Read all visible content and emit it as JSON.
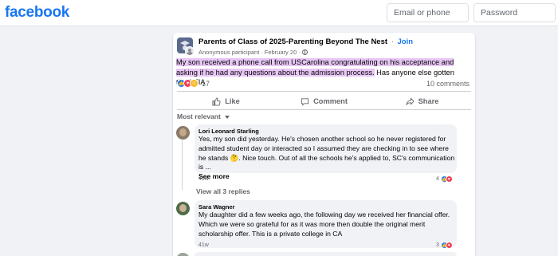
{
  "header": {
    "logo": "facebook",
    "email_placeholder": "Email or phone",
    "password_placeholder": "Password"
  },
  "post": {
    "group_name": "Parents of Class of 2025-Parenting Beyond The Nest",
    "separator": "·",
    "join_label": "Join",
    "author": "Anonymous participant",
    "date": "February 20",
    "body_highlighted": "My son received a phone call from USCarolina  congratulating on his acceptance and asking if he had any questions about the admission process.",
    "body_rest": " Has anyone else gotten this?  TIA",
    "reaction_count": "17",
    "comments_label": "10 comments",
    "actions": {
      "like": "Like",
      "comment": "Comment",
      "share": "Share"
    }
  },
  "comments_section": {
    "sort_label": "Most relevant",
    "view_replies": "View all 3 replies",
    "items": [
      {
        "author": "Lori Leonard Starling",
        "text": "Yes, my son did yesterday. He's chosen another school so he never registered for admitted student day or interacted so I assumed they are checking in to see where he stands 🤔. Nice touch. Out of all the schools he's applied to, SC's communication is ...",
        "see_more": "See more",
        "time": "41w",
        "reaction_count": "4"
      },
      {
        "author": "Sara Wagner",
        "text": "My daughter did a few weeks ago, the following day we received her financial offer. Which we were so grateful for as it was more then double the original merit scholarship offer. This is a private college in CA",
        "time": "41w",
        "reaction_count": "3"
      }
    ]
  },
  "colors": {
    "brand": "#1877f2",
    "highlight": "#e7c6f5",
    "page_bg": "#f0f2f5"
  }
}
